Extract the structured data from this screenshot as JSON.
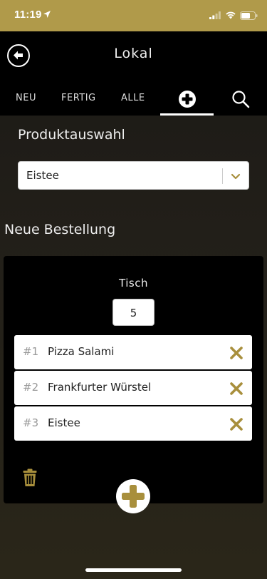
{
  "status_bar": {
    "time": "11:19"
  },
  "header": {
    "title": "Lokal"
  },
  "tabs": [
    {
      "label": "NEU"
    },
    {
      "label": "FERTIG"
    },
    {
      "label": "ALLE"
    }
  ],
  "product_selection": {
    "title": "Produktauswahl",
    "selected": "Eistee"
  },
  "new_order": {
    "title": "Neue Bestellung",
    "table_label": "Tisch",
    "table_value": "5",
    "items": [
      {
        "num": "#1",
        "name": "Pizza Salami"
      },
      {
        "num": "#2",
        "name": "Frankfurter Würstel"
      },
      {
        "num": "#3",
        "name": "Eistee"
      }
    ]
  },
  "colors": {
    "accent": "#b09a4a",
    "accent_icon": "#a88f3c"
  },
  "icons": [
    "location-arrow-icon",
    "signal-icon",
    "wifi-icon",
    "battery-icon",
    "back-arrow-icon",
    "plus-circle-icon",
    "search-icon",
    "chevron-down-icon",
    "close-icon",
    "trash-icon",
    "plus-icon"
  ]
}
